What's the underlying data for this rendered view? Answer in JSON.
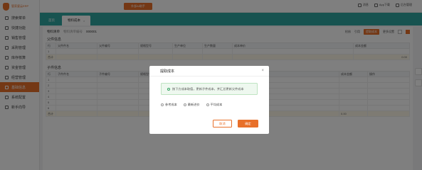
{
  "sidebar": {
    "logo_text": "管家婆云ERP",
    "items": [
      {
        "label": "搜索菜单"
      },
      {
        "label": "快捷功能"
      },
      {
        "label": "销售管理"
      },
      {
        "label": "采购管理"
      },
      {
        "label": "库存核算"
      },
      {
        "label": "资金管理"
      },
      {
        "label": "经营管理"
      },
      {
        "label": "基础信息"
      },
      {
        "label": "系统配置"
      },
      {
        "label": "新手向导"
      }
    ]
  },
  "topbar": {
    "ai_button": "外部AI助手",
    "tools": [
      "消息",
      "App下载",
      "后台管理"
    ]
  },
  "tabs": [
    {
      "label": "首页"
    },
    {
      "label": "物料成本"
    }
  ],
  "document": {
    "label": "物料清单",
    "type_label": "物料清单编号",
    "number": "000001",
    "tools": [
      "检核",
      "引用",
      "提取成本",
      "更多设置"
    ]
  },
  "parent": {
    "title": "父件信息",
    "columns": [
      "行",
      "父件件名",
      "父件编号",
      "规格型号",
      "生产单位",
      "生产数量",
      "成本单价",
      "成本金额"
    ],
    "row_num": "1",
    "sum_label": "合计",
    "sum_value": "0.00"
  },
  "child": {
    "title": "子件信息",
    "columns": [
      "行",
      "子件件名",
      "子件编号",
      "规格型号",
      "",
      "",
      "成本单价",
      "成本金额",
      "操作"
    ],
    "rows": [
      "1",
      "2",
      "3",
      "4",
      "5",
      "6"
    ],
    "sum_label": "合计",
    "sum_values": [
      "0.00",
      "0.00"
    ]
  },
  "dialog": {
    "title": "提取成本",
    "tip": "按下方成本取值，更新子件成本，并汇总更新父件成本",
    "options": [
      "参考成本",
      "最新进价",
      "平均成本"
    ],
    "cancel": "取消",
    "confirm": "确定"
  }
}
